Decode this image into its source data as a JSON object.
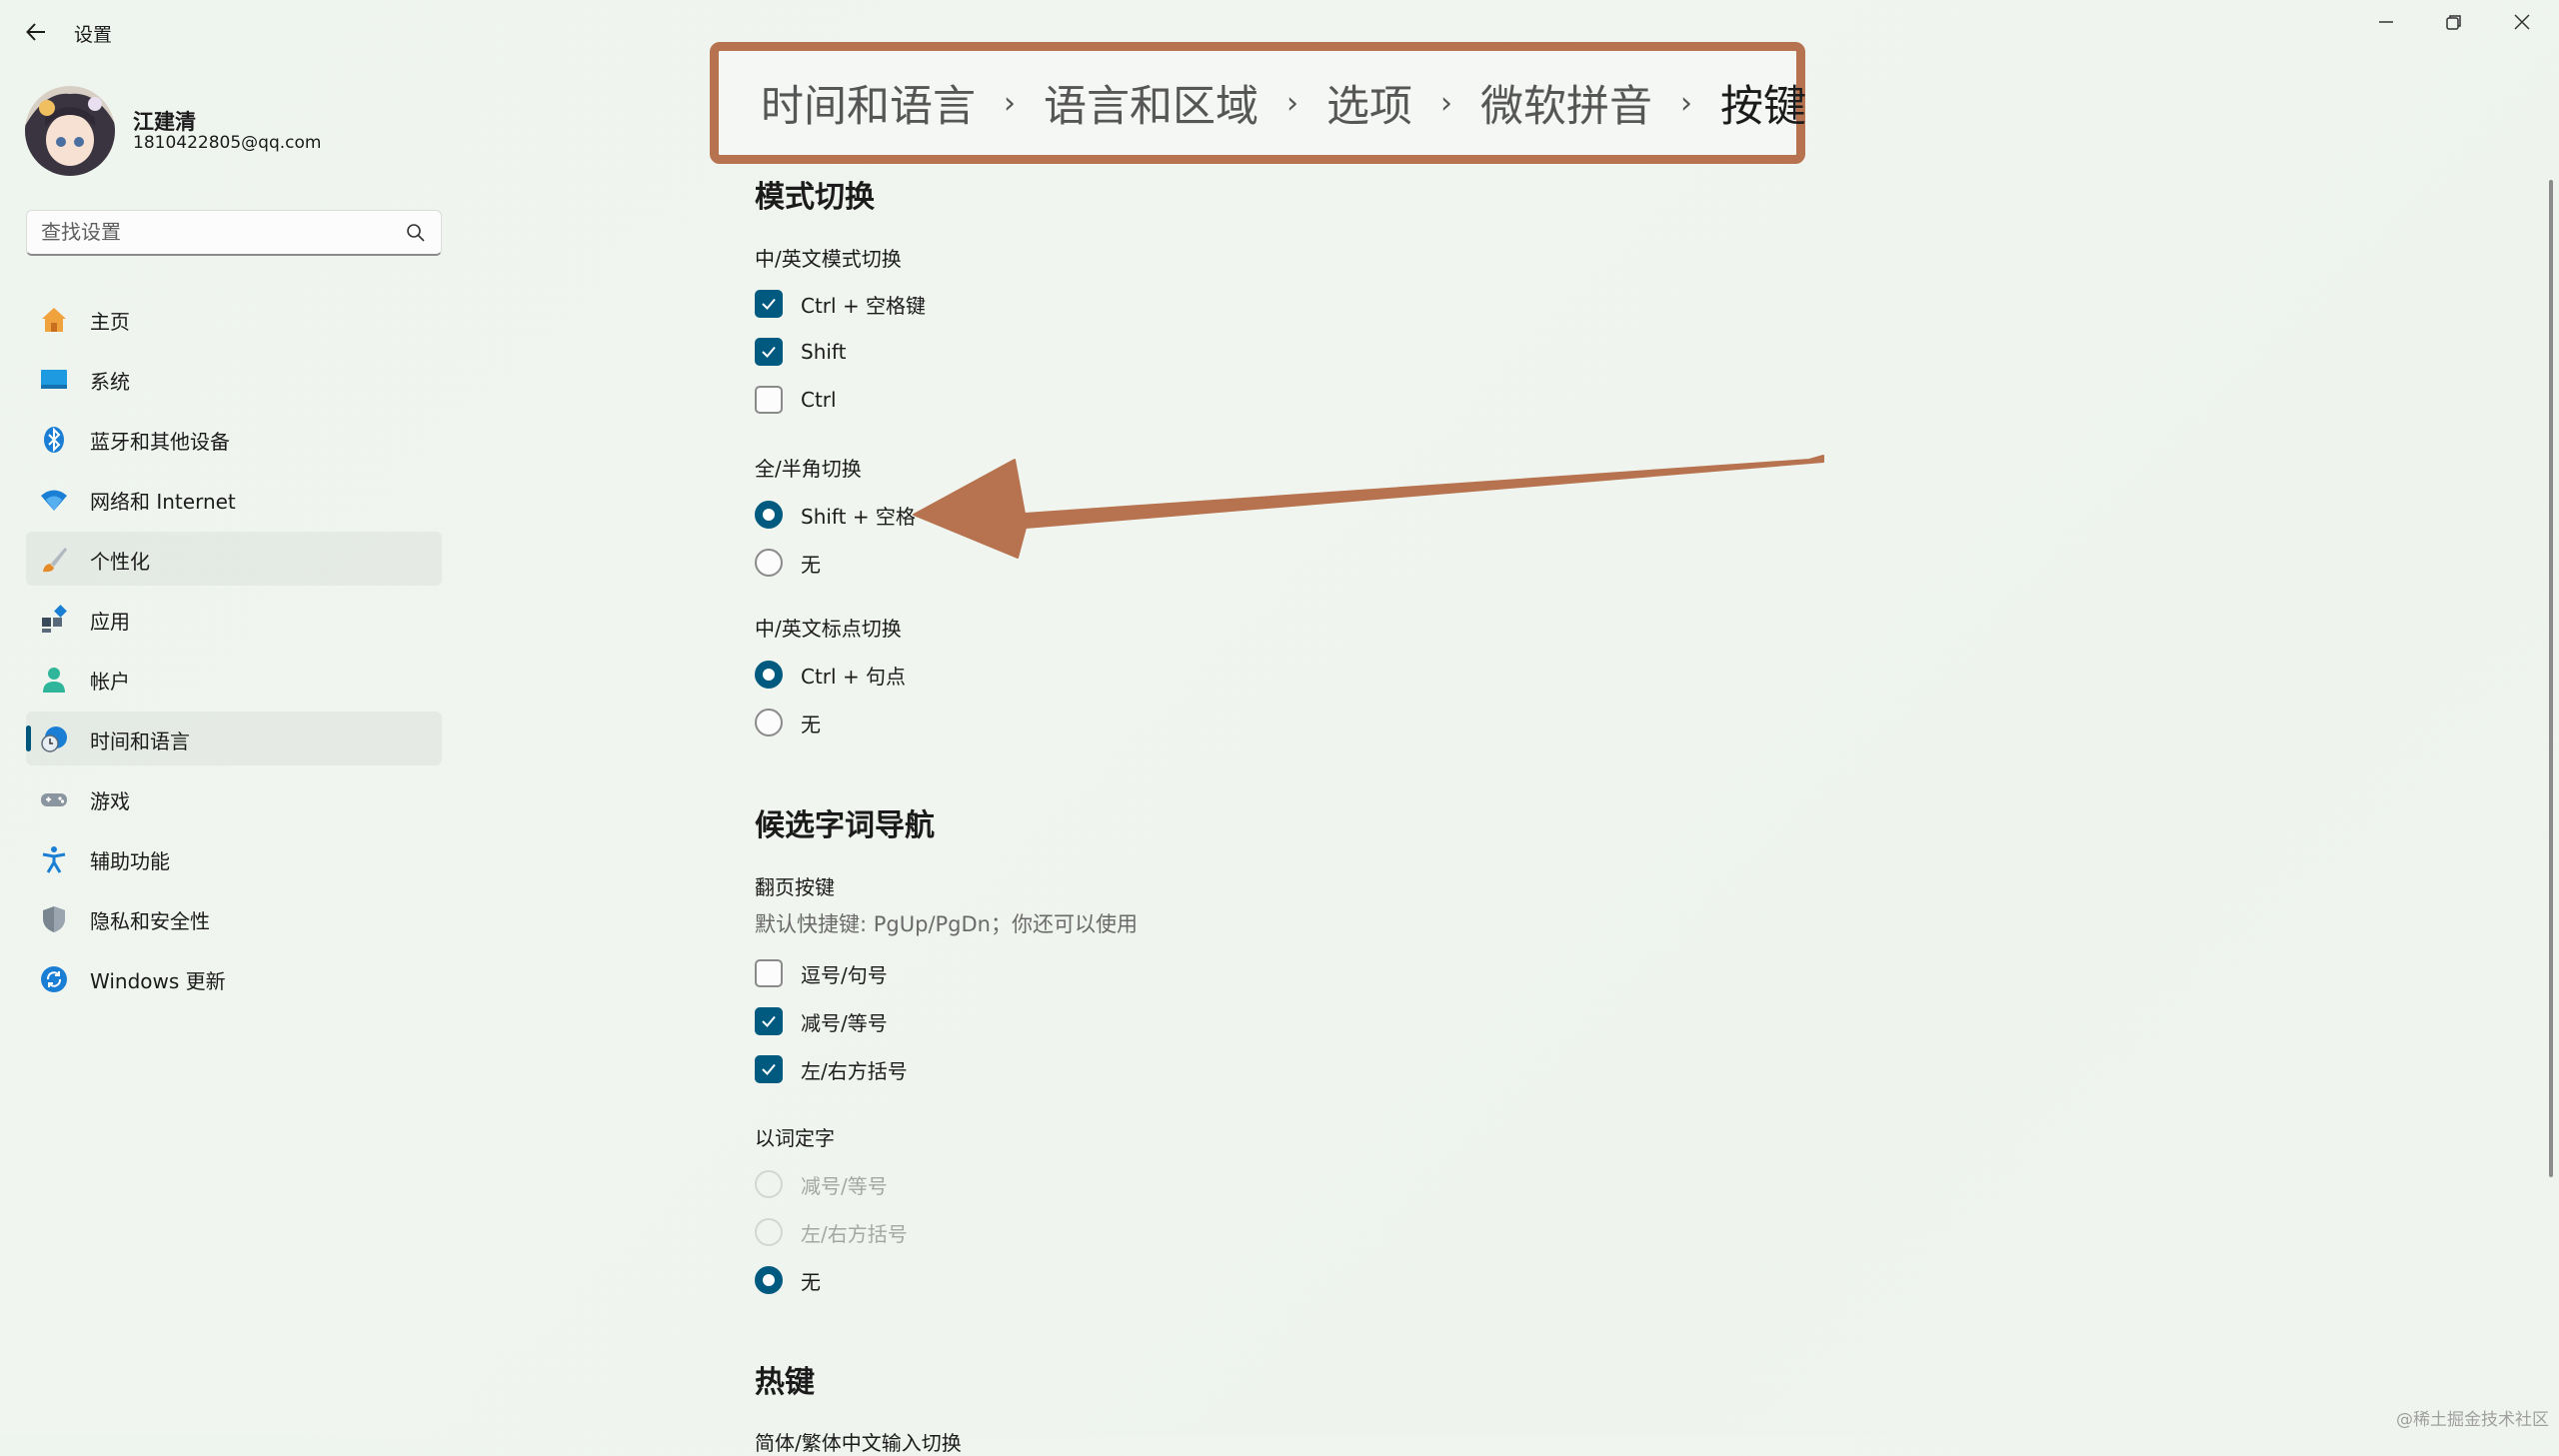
{
  "app": {
    "title": "设置"
  },
  "window": {
    "minimize_icon": "minimize-icon",
    "restore_icon": "restore-icon",
    "close_icon": "close-icon"
  },
  "user": {
    "name": "江建清",
    "email": "1810422805@qq.com"
  },
  "search": {
    "placeholder": "查找设置"
  },
  "sidebar": {
    "items": [
      {
        "label": "主页",
        "icon": "home-icon"
      },
      {
        "label": "系统",
        "icon": "system-icon"
      },
      {
        "label": "蓝牙和其他设备",
        "icon": "bluetooth-icon"
      },
      {
        "label": "网络和 Internet",
        "icon": "wifi-icon"
      },
      {
        "label": "个性化",
        "icon": "brush-icon"
      },
      {
        "label": "应用",
        "icon": "apps-icon"
      },
      {
        "label": "帐户",
        "icon": "account-icon"
      },
      {
        "label": "时间和语言",
        "icon": "time-language-icon",
        "selected": true
      },
      {
        "label": "游戏",
        "icon": "gamepad-icon"
      },
      {
        "label": "辅助功能",
        "icon": "accessibility-icon"
      },
      {
        "label": "隐私和安全性",
        "icon": "shield-icon"
      },
      {
        "label": "Windows 更新",
        "icon": "update-icon"
      }
    ]
  },
  "breadcrumb": {
    "items": [
      "时间和语言",
      "语言和区域",
      "选项",
      "微软拼音",
      "按键"
    ],
    "separator": "›",
    "highlight_color": "#b7724f"
  },
  "sections": {
    "mode_switch": {
      "title": "模式切换",
      "cn_en_mode": {
        "label": "中/英文模式切换",
        "options": [
          {
            "label": "Ctrl + 空格键",
            "checked": true
          },
          {
            "label": "Shift",
            "checked": true
          },
          {
            "label": "Ctrl",
            "checked": false
          }
        ]
      },
      "full_half": {
        "label": "全/半角切换",
        "options": [
          {
            "label": "Shift + 空格",
            "selected": true
          },
          {
            "label": "无",
            "selected": false
          }
        ]
      },
      "punct": {
        "label": "中/英文标点切换",
        "options": [
          {
            "label": "Ctrl + 句点",
            "selected": true
          },
          {
            "label": "无",
            "selected": false
          }
        ]
      }
    },
    "candidate_nav": {
      "title": "候选字词导航",
      "page_keys": {
        "label": "翻页按键",
        "description": "默认快捷键: PgUp/PgDn；你还可以使用",
        "options": [
          {
            "label": "逗号/句号",
            "checked": false
          },
          {
            "label": "减号/等号",
            "checked": true
          },
          {
            "label": "左/右方括号",
            "checked": true
          }
        ]
      },
      "word_to_char": {
        "label": "以词定字",
        "options": [
          {
            "label": "减号/等号",
            "selected": false,
            "disabled": true
          },
          {
            "label": "左/右方括号",
            "selected": false,
            "disabled": true
          },
          {
            "label": "无",
            "selected": true,
            "disabled": false
          }
        ]
      }
    },
    "hotkeys": {
      "title": "热键",
      "partial_label": "简体/繁体中文输入切换"
    }
  },
  "colors": {
    "accent": "#005a80",
    "annotation": "#b7724f"
  },
  "watermark": "@稀土掘金技术社区"
}
